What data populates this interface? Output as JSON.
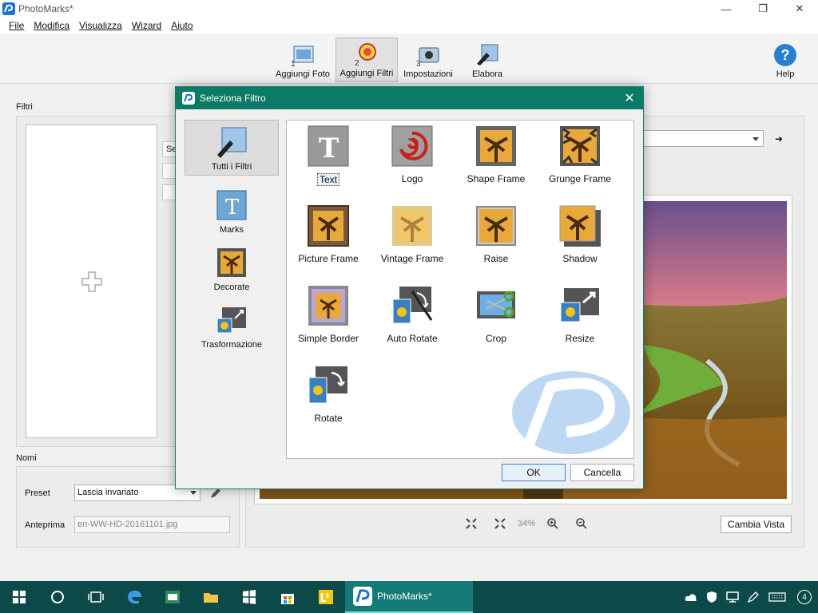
{
  "window": {
    "title": "PhotoMarks*"
  },
  "menu": [
    "File",
    "Modifica",
    "Visualizza",
    "Wizard",
    "Aiuto"
  ],
  "toolbar": {
    "tools": [
      {
        "label": "Aggiungi Foto",
        "num": "1"
      },
      {
        "label": "Aggiungi Filtri",
        "num": "2"
      },
      {
        "label": "Impostazioni",
        "num": "3"
      },
      {
        "label": "Elabora"
      }
    ],
    "help": "Help",
    "help_glyph": "?"
  },
  "main": {
    "filtri_label": "Filtri",
    "side_btn_text": "Se",
    "nomi_label": "Nomi",
    "preset_label": "Preset",
    "preset_value": "Lascia invariato",
    "anteprima_label": "Anteprima",
    "anteprima_value": "en-WW-HD-20161101.jpg",
    "zoom_text": "34%",
    "cambia_vista": "Cambia Vista"
  },
  "dialog": {
    "title": "Seleziona Filtro",
    "categories": [
      "Tutti i Filtri",
      "Marks",
      "Decorate",
      "Trasformazione"
    ],
    "filters": [
      "Text",
      "Logo",
      "Shape Frame",
      "Grunge Frame",
      "Picture Frame",
      "Vintage Frame",
      "Raise",
      "Shadow",
      "Simple Border",
      "Auto Rotate",
      "Crop",
      "Resize",
      "Rotate"
    ],
    "ok": "OK",
    "cancel": "Cancella"
  },
  "taskbar": {
    "app": "PhotoMarks*",
    "notifications": "4"
  }
}
